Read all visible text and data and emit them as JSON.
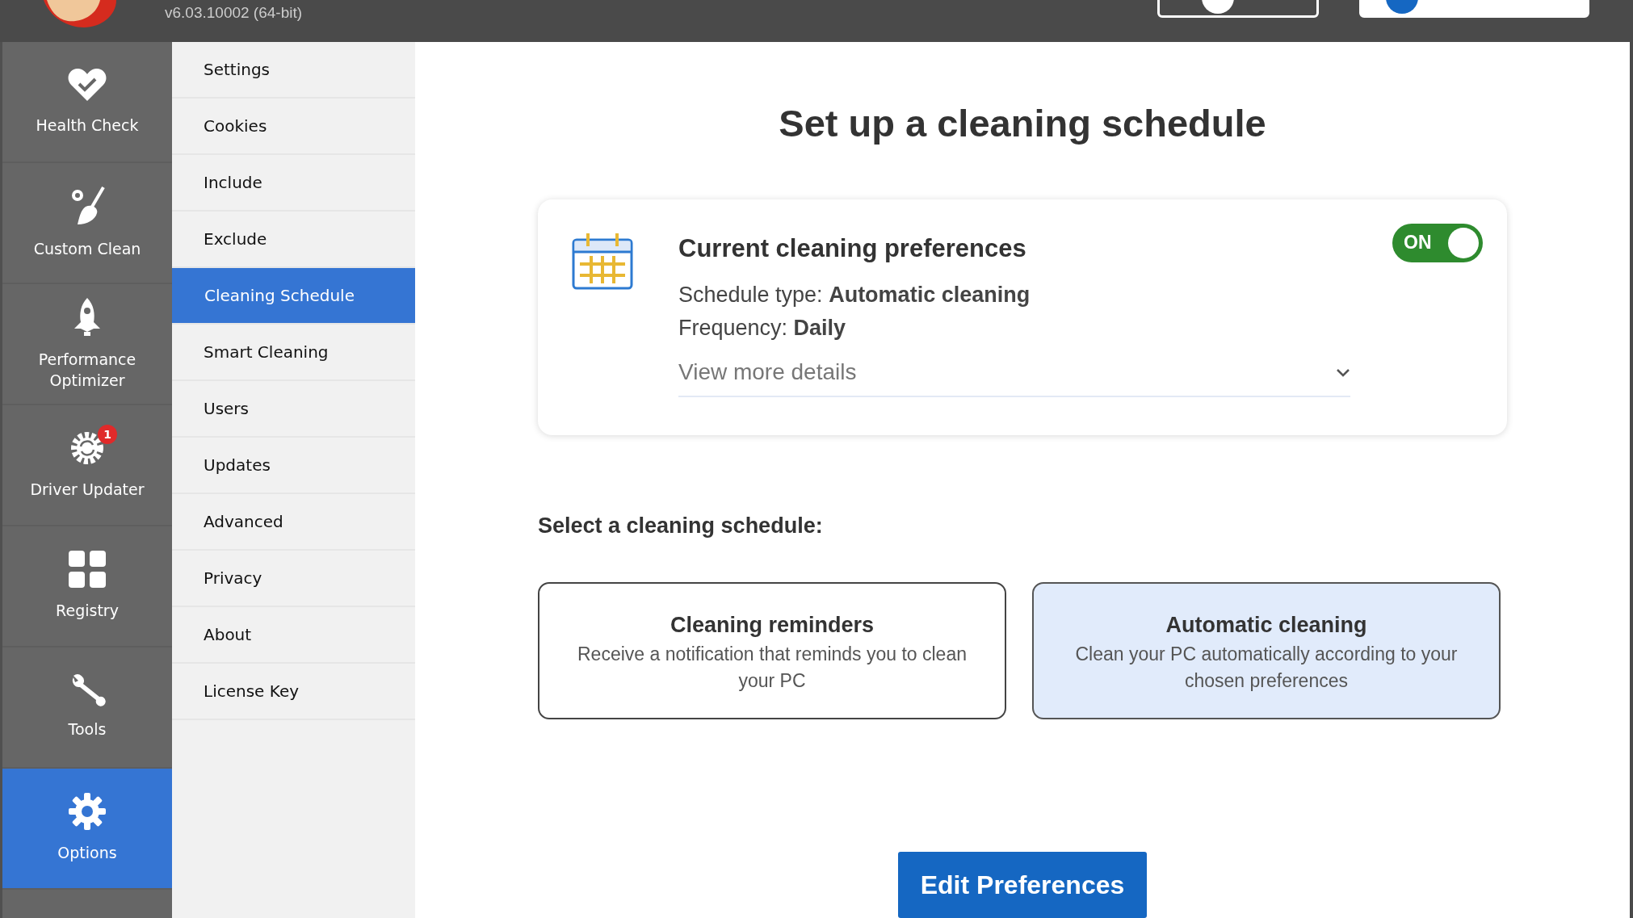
{
  "header": {
    "version": "v6.03.10002 (64-bit)",
    "buttons": [
      {
        "kind": "help"
      },
      {
        "kind": "account"
      }
    ]
  },
  "nav": [
    {
      "label": "Health Check",
      "kind": "health",
      "selected": false
    },
    {
      "label": "Custom Clean",
      "kind": "clean",
      "selected": false
    },
    {
      "label": "Performance Optimizer",
      "kind": "rocket",
      "selected": false
    },
    {
      "label": "Driver Updater",
      "kind": "driver",
      "badge": "1",
      "selected": false
    },
    {
      "label": "Registry",
      "kind": "registry",
      "selected": false
    },
    {
      "label": "Tools",
      "kind": "tools",
      "selected": false
    },
    {
      "label": "Options",
      "kind": "options",
      "selected": true
    }
  ],
  "submenu": [
    {
      "label": "Settings",
      "selected": false
    },
    {
      "label": "Cookies",
      "selected": false
    },
    {
      "label": "Include",
      "selected": false
    },
    {
      "label": "Exclude",
      "selected": false
    },
    {
      "label": "Cleaning Schedule",
      "selected": true
    },
    {
      "label": "Smart Cleaning",
      "selected": false
    },
    {
      "label": "Users",
      "selected": false
    },
    {
      "label": "Updates",
      "selected": false
    },
    {
      "label": "Advanced",
      "selected": false
    },
    {
      "label": "Privacy",
      "selected": false
    },
    {
      "label": "About",
      "selected": false
    },
    {
      "label": "License Key",
      "selected": false
    }
  ],
  "page": {
    "title": "Set up a cleaning schedule",
    "card": {
      "heading": "Current cleaning preferences",
      "lines": [
        "Schedule type: **Automatic cleaning**",
        "Frequency: **Daily**"
      ],
      "toggle": {
        "label": "ON",
        "on": true
      },
      "details": "View more details"
    },
    "select_label": "Select a cleaning schedule:",
    "options": [
      {
        "title": "Cleaning reminders",
        "description": "Receive a notification that reminds you to clean your PC",
        "selected": false
      },
      {
        "title": "Automatic cleaning",
        "description": "Clean your PC automatically according to your chosen preferences",
        "selected": true
      }
    ],
    "button": "Edit Preferences"
  }
}
